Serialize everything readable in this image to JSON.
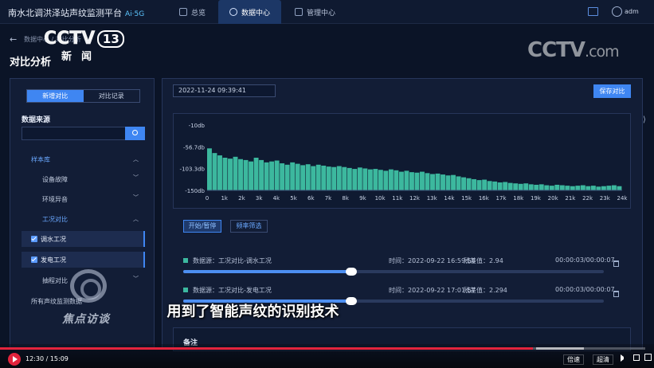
{
  "app": {
    "title": "南水北调洪泽站声纹监测平台",
    "badge": "Ai·5G",
    "nav": [
      {
        "label": "总览",
        "icon": "overview-icon"
      },
      {
        "label": "数据中心",
        "icon": "data-center-icon"
      },
      {
        "label": "管理中心",
        "icon": "settings-icon"
      }
    ],
    "user": "adm"
  },
  "breadcrumb": {
    "text": "数据中心 / 对比分析"
  },
  "page": {
    "title": "对比分析"
  },
  "broadcast": {
    "channel_logo": "CCTV",
    "channel_num": "13",
    "channel_sub": "新闻",
    "watermark_right": "CCTV",
    "watermark_right_sub": ".com",
    "program": "焦点访谈",
    "subtitle": "用到了智能声纹的识别技术"
  },
  "left": {
    "tabs": [
      "新增对比",
      "对比记录"
    ],
    "source_label": "数据来源",
    "search_value": "",
    "tree": {
      "root": "样本库",
      "groups": [
        "设备故障",
        "环境异音",
        "工况对比"
      ],
      "selected": [
        "调水工况",
        "发电工况"
      ],
      "more": [
        "抽程对比",
        "所有声纹监测数据"
      ]
    }
  },
  "main": {
    "date": "2022-11-24 09:39:41",
    "save_label": "保存对比",
    "start_label": "开始/暂停",
    "filter_label": "频率筛选",
    "records": [
      {
        "source": "数据源：工况对比-调水工况",
        "time": "时间：2022-09-22 16:59:58",
        "diff": "残差值：2.94",
        "duration": "00:00:03/00:00:07",
        "progress": 0.4
      },
      {
        "source": "数据源：工况对比-发电工况",
        "time": "时间：2022-09-22 17:01:57",
        "diff": "残差值：2.294",
        "duration": "00:00:03/00:00:07",
        "progress": 0.4
      }
    ],
    "remark_label": "备注"
  },
  "player": {
    "time": "12:30 / 15:09",
    "progress": 0.826,
    "speed_label": "倍速",
    "quality_label": "超清"
  },
  "chart_data": {
    "type": "bar",
    "title": "",
    "xlabel": "",
    "ylabel": "",
    "x_ticks": [
      "0",
      "1k",
      "2k",
      "3k",
      "4k",
      "5k",
      "6k",
      "7k",
      "8k",
      "9k",
      "10k",
      "11k",
      "12k",
      "13k",
      "14k",
      "15k",
      "16k",
      "17k",
      "18k",
      "19k",
      "20k",
      "21k",
      "22k",
      "23k",
      "24k"
    ],
    "y_ticks": [
      "-10db",
      "-56.7db",
      "-103.3db",
      "-150db"
    ],
    "ylim": [
      -150,
      -10
    ],
    "xlim": [
      0,
      24000
    ],
    "series": [
      {
        "color": "#3cb89e",
        "bin_width_hz": 300,
        "values": [
          -60,
          -70,
          -75,
          -80,
          -82,
          -78,
          -83,
          -85,
          -88,
          -80,
          -85,
          -90,
          -88,
          -86,
          -92,
          -95,
          -90,
          -93,
          -96,
          -94,
          -98,
          -95,
          -97,
          -99,
          -100,
          -98,
          -100,
          -102,
          -104,
          -101,
          -103,
          -105,
          -104,
          -106,
          -108,
          -105,
          -107,
          -110,
          -108,
          -111,
          -112,
          -110,
          -113,
          -115,
          -114,
          -116,
          -118,
          -117,
          -120,
          -122,
          -124,
          -126,
          -128,
          -127,
          -130,
          -131,
          -133,
          -132,
          -134,
          -135,
          -136,
          -135,
          -137,
          -138,
          -137,
          -139,
          -140,
          -138,
          -139,
          -140,
          -141,
          -140,
          -139,
          -141,
          -140,
          -142,
          -141,
          -140,
          -139,
          -141
        ]
      }
    ]
  }
}
